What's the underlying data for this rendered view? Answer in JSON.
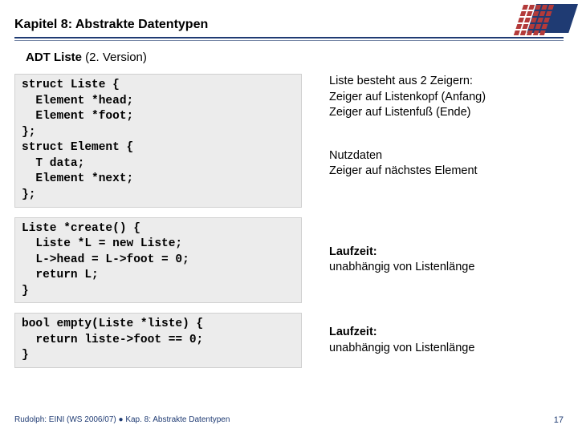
{
  "header": {
    "chapter": "Kapitel 8: Abstrakte Datentypen",
    "subtitle_bold": "ADT Liste",
    "subtitle_rest": " (2. Version)"
  },
  "blocks": [
    {
      "code": "struct Liste {\n  Element *head;\n  Element *foot;\n};\nstruct Element {\n  T data;\n  Element *next;\n};",
      "desc_top": "Liste besteht aus 2 Zeigern:\nZeiger auf Listenkopf (Anfang)\nZeiger auf Listenfuß (Ende)",
      "desc_bottom": "Nutzdaten\nZeiger auf nächstes Element"
    },
    {
      "code": "Liste *create() {\n  Liste *L = new Liste;\n  L->head = L->foot = 0;\n  return L;\n}",
      "desc_label": "Laufzeit:",
      "desc_text": "unabhängig von Listenlänge"
    },
    {
      "code": "bool empty(Liste *liste) {\n  return liste->foot == 0;\n}",
      "desc_label": "Laufzeit:",
      "desc_text": "unabhängig von Listenlänge"
    }
  ],
  "footer": {
    "left": "Rudolph: EINI (WS 2006/07)  ●  Kap. 8: Abstrakte Datentypen",
    "page": "17"
  }
}
